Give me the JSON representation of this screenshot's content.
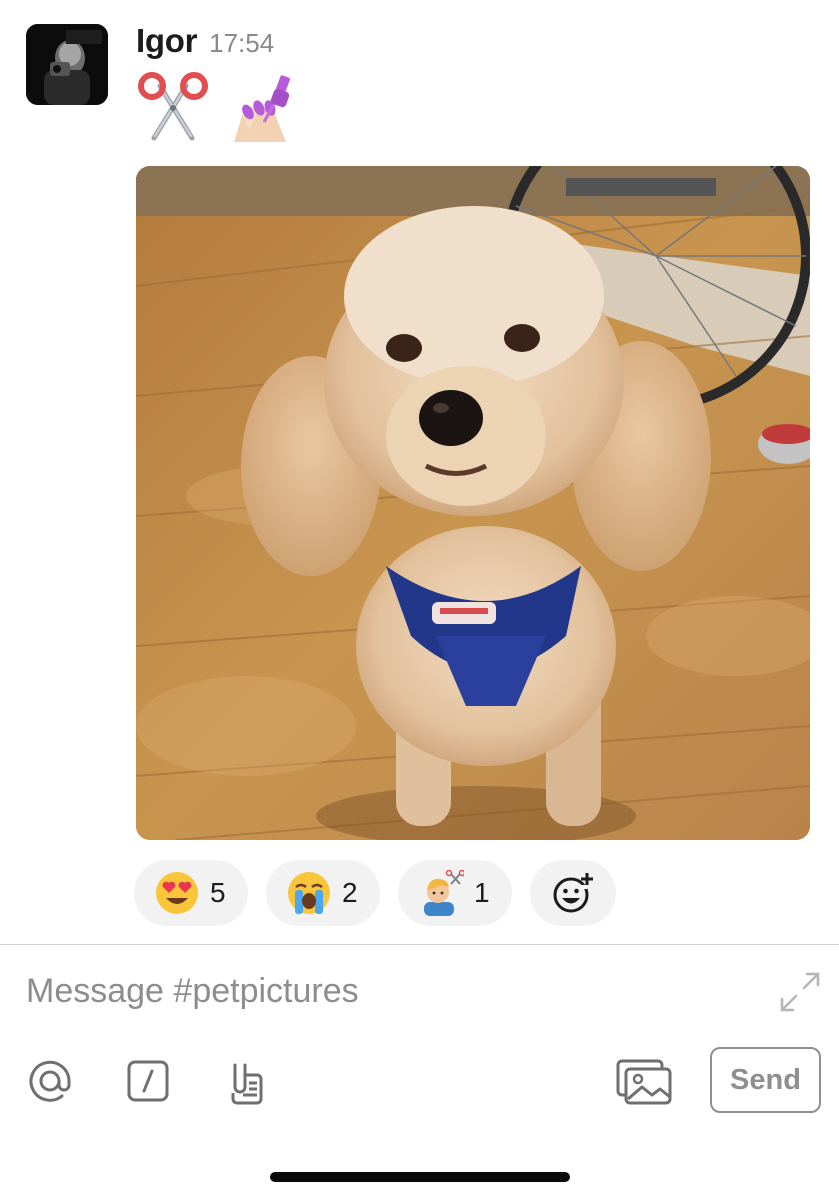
{
  "message": {
    "author": "Igor",
    "time": "17:54",
    "emojis": [
      "scissors-emoji",
      "nail-polish-emoji"
    ],
    "image": "photo of a cream-colored poodle wearing a blue harness sitting on a wooden floor"
  },
  "reactions": [
    {
      "emoji": "heart-eyes-emoji",
      "count": "5"
    },
    {
      "emoji": "loudly-crying-emoji",
      "count": "2"
    },
    {
      "emoji": "haircut-emoji",
      "count": "1"
    }
  ],
  "add_reaction": {
    "icon": "add-reaction-icon"
  },
  "composer": {
    "placeholder": "Message #petpictures",
    "send_label": "Send"
  },
  "icons": {
    "mention": "at-icon",
    "slash": "slash-command-icon",
    "attach": "file-attach-icon",
    "photos": "photo-gallery-icon",
    "expand": "expand-icon"
  },
  "colors": {
    "text": "#1d1c1d",
    "muted": "#8a8a8a",
    "reaction_bg": "#f2f2f2",
    "divider": "#cfcfcf"
  }
}
